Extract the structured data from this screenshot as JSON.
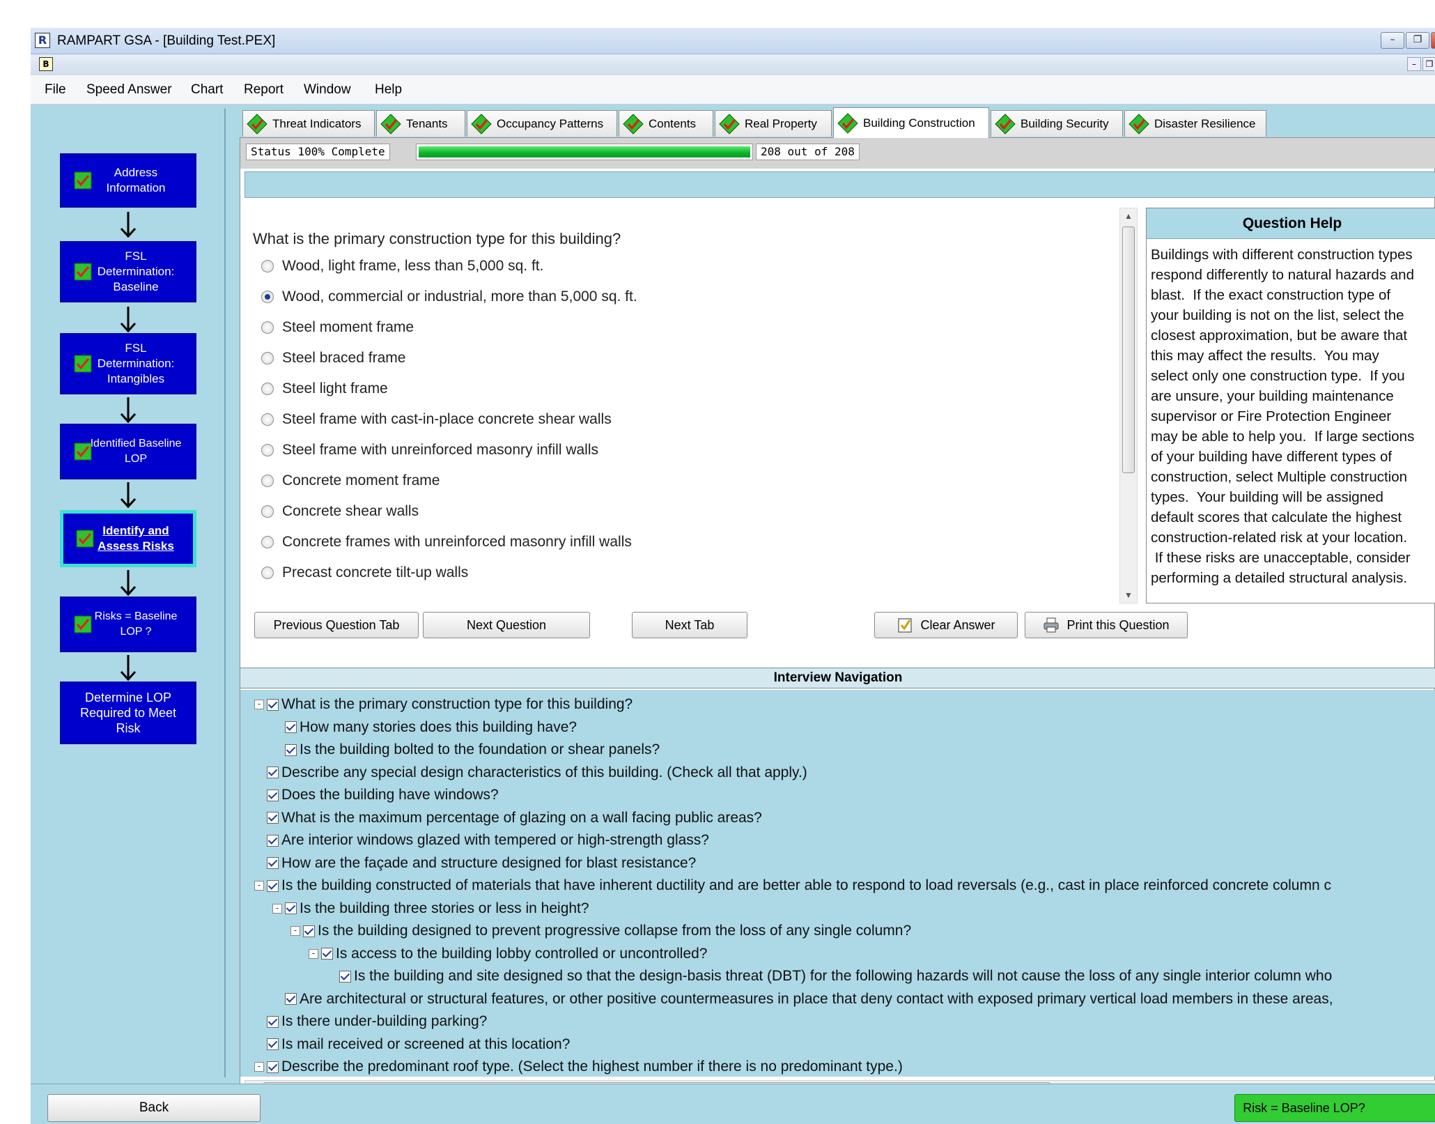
{
  "window": {
    "title": "RAMPART GSA - [Building Test.PEX]",
    "app_icon": "R",
    "mdi_icon": "B",
    "controls": [
      "minimize",
      "restore",
      "close"
    ]
  },
  "menu": {
    "file": "File",
    "speed_answer": "Speed Answer",
    "chart": "Chart",
    "report": "Report",
    "window": "Window",
    "help": "Help"
  },
  "sidebar": {
    "steps": [
      {
        "label": "Address\nInformation",
        "checked": true
      },
      {
        "label": "FSL\nDetermination:\nBaseline",
        "checked": true
      },
      {
        "label": "FSL\nDetermination:\nIntangibles",
        "checked": true
      },
      {
        "label": "Identified Baseline\nLOP",
        "checked": true
      },
      {
        "label": "Identify and\nAssess Risks",
        "checked": true,
        "active": true
      },
      {
        "label": "Risks = Baseline\nLOP ?",
        "checked": true
      },
      {
        "label": "Determine LOP\nRequired to Meet\nRisk",
        "checked": false
      }
    ]
  },
  "tabs": [
    {
      "label": "Threat Indicators"
    },
    {
      "label": "Tenants"
    },
    {
      "label": "Occupancy Patterns"
    },
    {
      "label": "Contents"
    },
    {
      "label": "Real Property"
    },
    {
      "label": "Building Construction",
      "active": true
    },
    {
      "label": "Building Security"
    },
    {
      "label": "Disaster Resilience"
    }
  ],
  "status": {
    "label": "Status 100% Complete",
    "progress": 1.0,
    "count": "208 out of 208"
  },
  "question": {
    "text": "What is the primary construction type for this building?",
    "options": [
      "Wood, light frame, less than 5,000 sq. ft.",
      "Wood, commercial or industrial, more than 5,000 sq. ft.",
      "Steel moment frame",
      "Steel braced frame",
      "Steel light frame",
      "Steel frame with cast-in-place concrete shear walls",
      "Steel frame with unreinforced masonry infill walls",
      "Concrete moment frame",
      "Concrete shear walls",
      "Concrete frames with unreinforced masonry infill walls",
      "Precast concrete tilt-up walls"
    ],
    "selected_index": 1
  },
  "help": {
    "title": "Question Help",
    "lines": [
      "Buildings with different construction types",
      "respond differently to natural hazards and",
      "blast.  If the exact construction type of",
      "your building is not on the list, select the",
      "closest approximation, but be aware that",
      "this may affect the results.  You may",
      "select only one construction type.  If you",
      "are unsure, your building maintenance",
      "supervisor or Fire Protection Engineer",
      "may be able to help you.  If large sections",
      "of your building have different types of",
      "construction, select Multiple construction",
      "types.  Your building will be assigned",
      "default scores that calculate the highest",
      "construction-related risk at your location.",
      " If these risks are unacceptable, consider",
      "performing a detailed structural analysis."
    ]
  },
  "buttons": {
    "previous_tab": "Previous Question Tab",
    "next_question": "Next Question",
    "next_tab": "Next Tab",
    "clear_answer": "Clear Answer",
    "print_question": "Print this Question"
  },
  "navigation": {
    "title": "Interview Navigation",
    "items": [
      {
        "depth": 0,
        "expander": "-",
        "text": "What is the primary construction type for this building?"
      },
      {
        "depth": 1,
        "text": "How many stories does this building have?"
      },
      {
        "depth": 1,
        "text": "Is the building bolted to the foundation or shear panels?"
      },
      {
        "depth": 0,
        "text": "Describe any special design characteristics of this building. (Check all that apply.)"
      },
      {
        "depth": 0,
        "text": "Does the building have windows?"
      },
      {
        "depth": 0,
        "text": "What is the maximum percentage of glazing on a wall facing public areas?"
      },
      {
        "depth": 0,
        "text": "Are interior windows glazed with tempered or high-strength glass?"
      },
      {
        "depth": 0,
        "text": "How are the façade and structure designed for blast resistance?"
      },
      {
        "depth": 0,
        "expander": "-",
        "text": "Is the building constructed of materials that have inherent ductility and are better able to respond to load reversals (e.g., cast in place reinforced concrete column c"
      },
      {
        "depth": 1,
        "expander": "-",
        "text": "Is the building three stories or less in height?"
      },
      {
        "depth": 2,
        "expander": "-",
        "text": "Is the building designed to prevent progressive collapse from the loss of any single column?"
      },
      {
        "depth": 3,
        "expander": "-",
        "text": "Is access to the building lobby controlled or uncontrolled?"
      },
      {
        "depth": 4,
        "text": "Is the building and site designed so that the design-basis threat (DBT) for the following hazards will not cause the loss of any single interior column who"
      },
      {
        "depth": 1,
        "text": "Are architectural or structural features, or other positive countermeasures in place that deny contact with exposed primary vertical load members in these areas,"
      },
      {
        "depth": 0,
        "text": "Is there under-building parking?"
      },
      {
        "depth": 0,
        "text": "Is mail received or screened at this location?"
      },
      {
        "depth": 0,
        "expander": "-",
        "text": "Describe the predominant roof type. (Select the highest number if there is no predominant type.)"
      }
    ]
  },
  "footer": {
    "back": "Back",
    "next": "Risk = Baseline LOP?"
  },
  "colors": {
    "background": "#add8e6",
    "step_box": "#0000cd",
    "active_border": "#40e0d0",
    "next_button": "#32cd32"
  }
}
